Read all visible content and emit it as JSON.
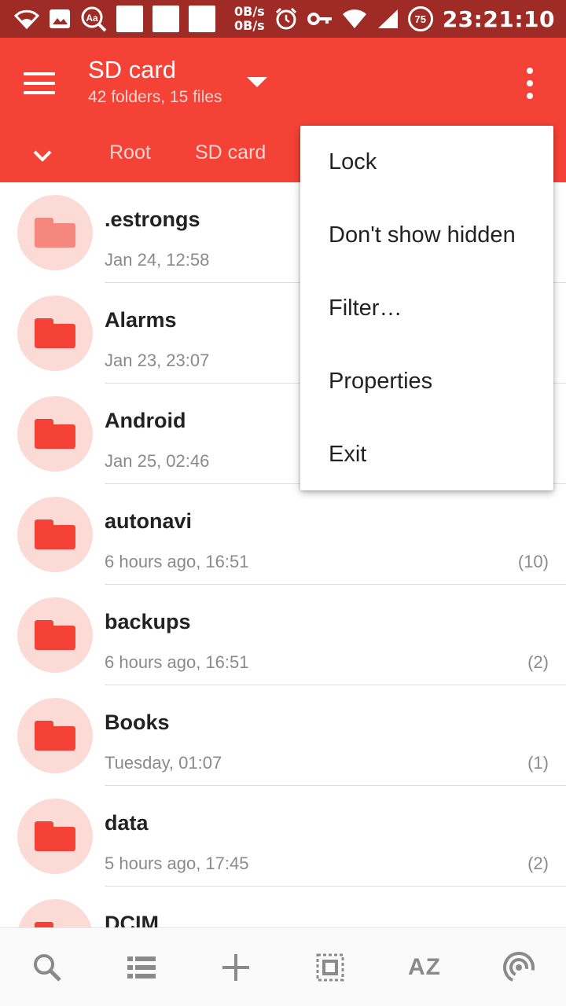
{
  "status_bar": {
    "net_speed_up": "0B/s",
    "net_speed_down": "0B/s",
    "battery_level": "75",
    "time": "23:21:10",
    "icons": [
      "wifi-icon",
      "image-icon",
      "font-magnifier-icon",
      "notification-placeholder",
      "notification-placeholder",
      "notification-placeholder",
      "alarm-icon",
      "vpn-key-icon",
      "wifi-signal-icon",
      "cell-signal-icon",
      "battery-badge"
    ]
  },
  "app_bar": {
    "title": "SD card",
    "subtitle": "42 folders, 15 files",
    "breadcrumbs": [
      "Root",
      "SD card"
    ],
    "background_color": "#f44236"
  },
  "files": [
    {
      "name": ".estrongs",
      "date": "Jan 24, 12:58",
      "count": "",
      "hidden": true
    },
    {
      "name": "Alarms",
      "date": "Jan 23, 23:07",
      "count": ""
    },
    {
      "name": "Android",
      "date": "Jan 25, 02:46",
      "count": ""
    },
    {
      "name": "autonavi",
      "date": "6 hours ago, 16:51",
      "count": "(10)"
    },
    {
      "name": "backups",
      "date": "6 hours ago, 16:51",
      "count": "(2)"
    },
    {
      "name": "Books",
      "date": "Tuesday, 01:07",
      "count": "(1)"
    },
    {
      "name": "data",
      "date": "5 hours ago, 17:45",
      "count": "(2)"
    },
    {
      "name": "DCIM",
      "date": "",
      "count": ""
    }
  ],
  "popup_menu": {
    "items": [
      "Lock",
      "Don't show hidden",
      "Filter…",
      "Properties",
      "Exit"
    ]
  },
  "bottom_toolbar": {
    "items": [
      {
        "icon": "search-icon"
      },
      {
        "icon": "list-view-icon"
      },
      {
        "icon": "add-icon"
      },
      {
        "icon": "select-all-icon"
      },
      {
        "icon": "sort-icon",
        "label": "AZ"
      },
      {
        "icon": "broadcast-icon"
      }
    ]
  }
}
